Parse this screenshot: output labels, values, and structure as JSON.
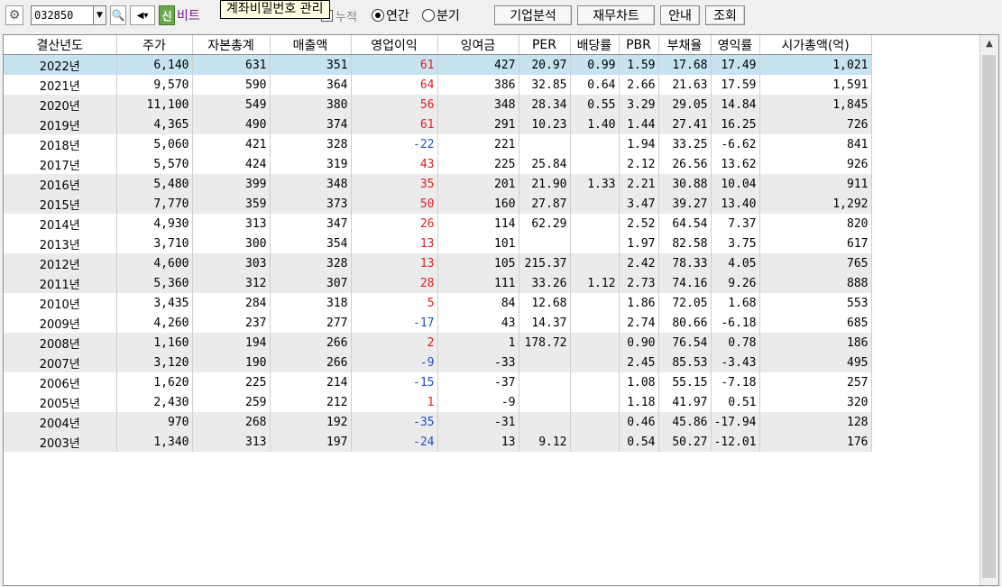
{
  "toolbar": {
    "code_value": "032850",
    "badge": "신",
    "name_fragment": "비트",
    "tooltip": "계좌비밀번호 관리",
    "check_label": "누적",
    "radio_annual": "연간",
    "radio_quarter": "분기",
    "btn_company": "기업분석",
    "btn_fin_chart": "재무차트",
    "btn_guide": "안내",
    "btn_query": "조회"
  },
  "table": {
    "headers": [
      "결산년도",
      "주가",
      "자본총계",
      "매출액",
      "영업이익",
      "잉여금",
      "PER",
      "배당률",
      "PBR",
      "부채율",
      "영익률",
      "시가총액(억)"
    ],
    "rows": [
      [
        "2022년",
        "6,140",
        "631",
        "351",
        "61",
        "427",
        "20.97",
        "0.99",
        "1.59",
        "17.68",
        "17.49",
        "1,021"
      ],
      [
        "2021년",
        "9,570",
        "590",
        "364",
        "64",
        "386",
        "32.85",
        "0.64",
        "2.66",
        "21.63",
        "17.59",
        "1,591"
      ],
      [
        "2020년",
        "11,100",
        "549",
        "380",
        "56",
        "348",
        "28.34",
        "0.55",
        "3.29",
        "29.05",
        "14.84",
        "1,845"
      ],
      [
        "2019년",
        "4,365",
        "490",
        "374",
        "61",
        "291",
        "10.23",
        "1.40",
        "1.44",
        "27.41",
        "16.25",
        "726"
      ],
      [
        "2018년",
        "5,060",
        "421",
        "328",
        "-22",
        "221",
        "",
        "",
        "1.94",
        "33.25",
        "-6.62",
        "841"
      ],
      [
        "2017년",
        "5,570",
        "424",
        "319",
        "43",
        "225",
        "25.84",
        "",
        "2.12",
        "26.56",
        "13.62",
        "926"
      ],
      [
        "2016년",
        "5,480",
        "399",
        "348",
        "35",
        "201",
        "21.90",
        "1.33",
        "2.21",
        "30.88",
        "10.04",
        "911"
      ],
      [
        "2015년",
        "7,770",
        "359",
        "373",
        "50",
        "160",
        "27.87",
        "",
        "3.47",
        "39.27",
        "13.40",
        "1,292"
      ],
      [
        "2014년",
        "4,930",
        "313",
        "347",
        "26",
        "114",
        "62.29",
        "",
        "2.52",
        "64.54",
        "7.37",
        "820"
      ],
      [
        "2013년",
        "3,710",
        "300",
        "354",
        "13",
        "101",
        "",
        "",
        "1.97",
        "82.58",
        "3.75",
        "617"
      ],
      [
        "2012년",
        "4,600",
        "303",
        "328",
        "13",
        "105",
        "215.37",
        "",
        "2.42",
        "78.33",
        "4.05",
        "765"
      ],
      [
        "2011년",
        "5,360",
        "312",
        "307",
        "28",
        "111",
        "33.26",
        "1.12",
        "2.73",
        "74.16",
        "9.26",
        "888"
      ],
      [
        "2010년",
        "3,435",
        "284",
        "318",
        "5",
        "84",
        "12.68",
        "",
        "1.86",
        "72.05",
        "1.68",
        "553"
      ],
      [
        "2009년",
        "4,260",
        "237",
        "277",
        "-17",
        "43",
        "14.37",
        "",
        "2.74",
        "80.66",
        "-6.18",
        "685"
      ],
      [
        "2008년",
        "1,160",
        "194",
        "266",
        "2",
        "1",
        "178.72",
        "",
        "0.90",
        "76.54",
        "0.78",
        "186"
      ],
      [
        "2007년",
        "3,120",
        "190",
        "266",
        "-9",
        "-33",
        "",
        "",
        "2.45",
        "85.53",
        "-3.43",
        "495"
      ],
      [
        "2006년",
        "1,620",
        "225",
        "214",
        "-15",
        "-37",
        "",
        "",
        "1.08",
        "55.15",
        "-7.18",
        "257"
      ],
      [
        "2005년",
        "2,430",
        "259",
        "212",
        "1",
        "-9",
        "",
        "",
        "1.18",
        "41.97",
        "0.51",
        "320"
      ],
      [
        "2004년",
        "970",
        "268",
        "192",
        "-35",
        "-31",
        "",
        "",
        "0.46",
        "45.86",
        "-17.94",
        "128"
      ],
      [
        "2003년",
        "1,340",
        "313",
        "197",
        "-24",
        "13",
        "9.12",
        "",
        "0.54",
        "50.27",
        "-12.01",
        "176"
      ]
    ]
  }
}
